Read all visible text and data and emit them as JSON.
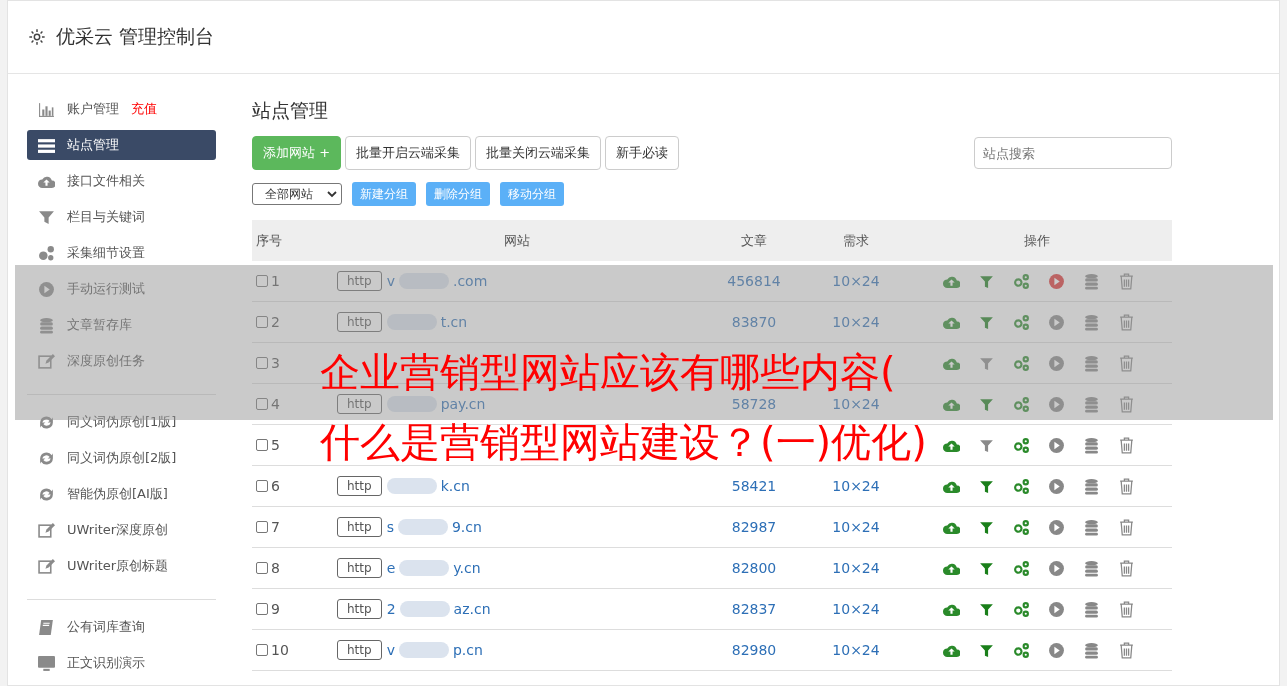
{
  "header": {
    "title": "优采云 管理控制台"
  },
  "sidebar": {
    "sections": [
      {
        "items": [
          {
            "kind": "chart",
            "label": "账户管理",
            "badge": "充值",
            "selected": false
          },
          {
            "kind": "server",
            "label": "站点管理",
            "selected": true
          },
          {
            "kind": "cloud",
            "label": "接口文件相关",
            "selected": false
          },
          {
            "kind": "filter",
            "label": "栏目与关键词",
            "selected": false
          },
          {
            "kind": "gears",
            "label": "采集细节设置",
            "selected": false
          },
          {
            "kind": "play",
            "label": "手动运行测试",
            "selected": false
          },
          {
            "kind": "database",
            "label": "文章暂存库",
            "selected": false
          },
          {
            "kind": "edit",
            "label": "深度原创任务",
            "selected": false
          }
        ]
      },
      {
        "items": [
          {
            "kind": "refresh",
            "label": "同义词伪原创[1版]",
            "selected": false
          },
          {
            "kind": "refresh",
            "label": "同义词伪原创[2版]",
            "selected": false
          },
          {
            "kind": "refresh",
            "label": "智能伪原创[AI版]",
            "selected": false
          },
          {
            "kind": "edit",
            "label": "UWriter深度原创",
            "selected": false
          },
          {
            "kind": "edit",
            "label": "UWriter原创标题",
            "selected": false
          }
        ]
      },
      {
        "items": [
          {
            "kind": "book",
            "label": "公有词库查询",
            "selected": false
          },
          {
            "kind": "monitor",
            "label": "正文识别演示",
            "selected": false
          }
        ]
      }
    ]
  },
  "main": {
    "title": "站点管理",
    "toolbar": [
      {
        "kind": "primary",
        "label": "添加网站 +"
      },
      {
        "kind": "default",
        "label": "批量开启云端采集"
      },
      {
        "kind": "default",
        "label": "批量关闭云端采集"
      },
      {
        "kind": "default",
        "label": "新手必读"
      }
    ],
    "search": {
      "placeholder": "站点搜索"
    },
    "group_select": {
      "value": "全部网站"
    },
    "group_buttons": [
      "新建分组",
      "删除分组",
      "移动分组"
    ],
    "table": {
      "columns": [
        "序号",
        "网站",
        "文章",
        "需求",
        "操作"
      ],
      "rows": [
        {
          "no": "1",
          "scheme": "http",
          "url_start": "v",
          "url_end": ".com",
          "articles": "456814",
          "need": "10×24",
          "checked": false,
          "filter_on": true,
          "running": true
        },
        {
          "no": "2",
          "scheme": "http",
          "url_end": "t.cn",
          "articles": "83870",
          "need": "10×24",
          "checked": false,
          "filter_on": true,
          "running": false
        },
        {
          "no": "3",
          "checked": false,
          "filter_on": false,
          "running": false
        },
        {
          "no": "4",
          "scheme": "http",
          "url_end": "pay.cn",
          "articles": "58728",
          "need": "10×24",
          "checked": false,
          "filter_on": true,
          "running": false
        },
        {
          "no": "5",
          "checked": false,
          "filter_on": false,
          "running": false
        },
        {
          "no": "6",
          "scheme": "http",
          "url_end": "k.cn",
          "articles": "58421",
          "need": "10×24",
          "checked": false,
          "filter_on": true,
          "running": false
        },
        {
          "no": "7",
          "scheme": "http",
          "url_start": "s",
          "url_end": "9.cn",
          "articles": "82987",
          "need": "10×24",
          "checked": false,
          "filter_on": true,
          "running": false
        },
        {
          "no": "8",
          "scheme": "http",
          "url_start": "e",
          "url_end": "y.cn",
          "articles": "82800",
          "need": "10×24",
          "checked": false,
          "filter_on": true,
          "running": false
        },
        {
          "no": "9",
          "scheme": "http",
          "url_start": "2",
          "url_end": "az.cn",
          "articles": "82837",
          "need": "10×24",
          "checked": false,
          "filter_on": true,
          "running": false
        },
        {
          "no": "10",
          "scheme": "http",
          "url_start": "v",
          "url_end": "p.cn",
          "articles": "82980",
          "need": "10×24",
          "checked": false,
          "filter_on": true,
          "running": false
        }
      ]
    }
  },
  "banner": {
    "lines": [
      "企业营销型网站应该有哪些内容(",
      "什么是营销型网站建设？(一)优化)"
    ]
  }
}
